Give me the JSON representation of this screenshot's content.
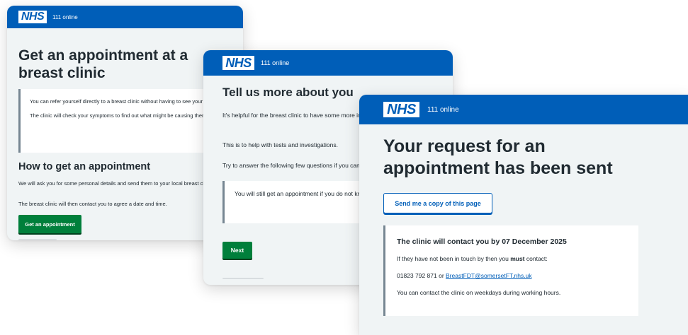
{
  "brand": {
    "logo_text": "NHS",
    "service_name": "111 online",
    "colors": {
      "header_blue": "#005eb8",
      "primary_green": "#007f3b",
      "inset_border": "#768692",
      "page_grey": "#f0f4f5"
    }
  },
  "card1": {
    "title": "Get an appointment at a breast clinic",
    "inset_p1": "You can refer yourself directly to a breast clinic without having to see your GP first.",
    "inset_p2": "The clinic will check your symptoms to find out what might be causing them.",
    "heading": "How to get an appointment",
    "p1": "We will ask you for some personal details and send them to your local breast clinic.",
    "p2": "The breast clinic will then contact you to agree a date and time.",
    "button_label": "Get an appointment"
  },
  "card2": {
    "title": "Tell us more about you",
    "p1": "It's helpful for the breast clinic to have some more information about you in advance.",
    "p2": "This is to help with tests and investigations.",
    "p3": "Try to answer the following few questions if you can.",
    "inset_text": "You will still get an appointment if you do not know the answers.",
    "button_label": "Next"
  },
  "card3": {
    "title": "Your request for an appointment has been sent",
    "copy_button_label": "Send me a copy of this page",
    "panel_heading": "The clinic will contact you by 07 December 2025",
    "p1_before": "If they have not been in touch by then you ",
    "p1_bold": "must",
    "p1_after": " contact:",
    "phone": "01823 792 871",
    "or_text": " or ",
    "email": "BreastFDT@somersetFT.nhs.uk",
    "p3": "You can contact the clinic on weekdays during working hours."
  }
}
